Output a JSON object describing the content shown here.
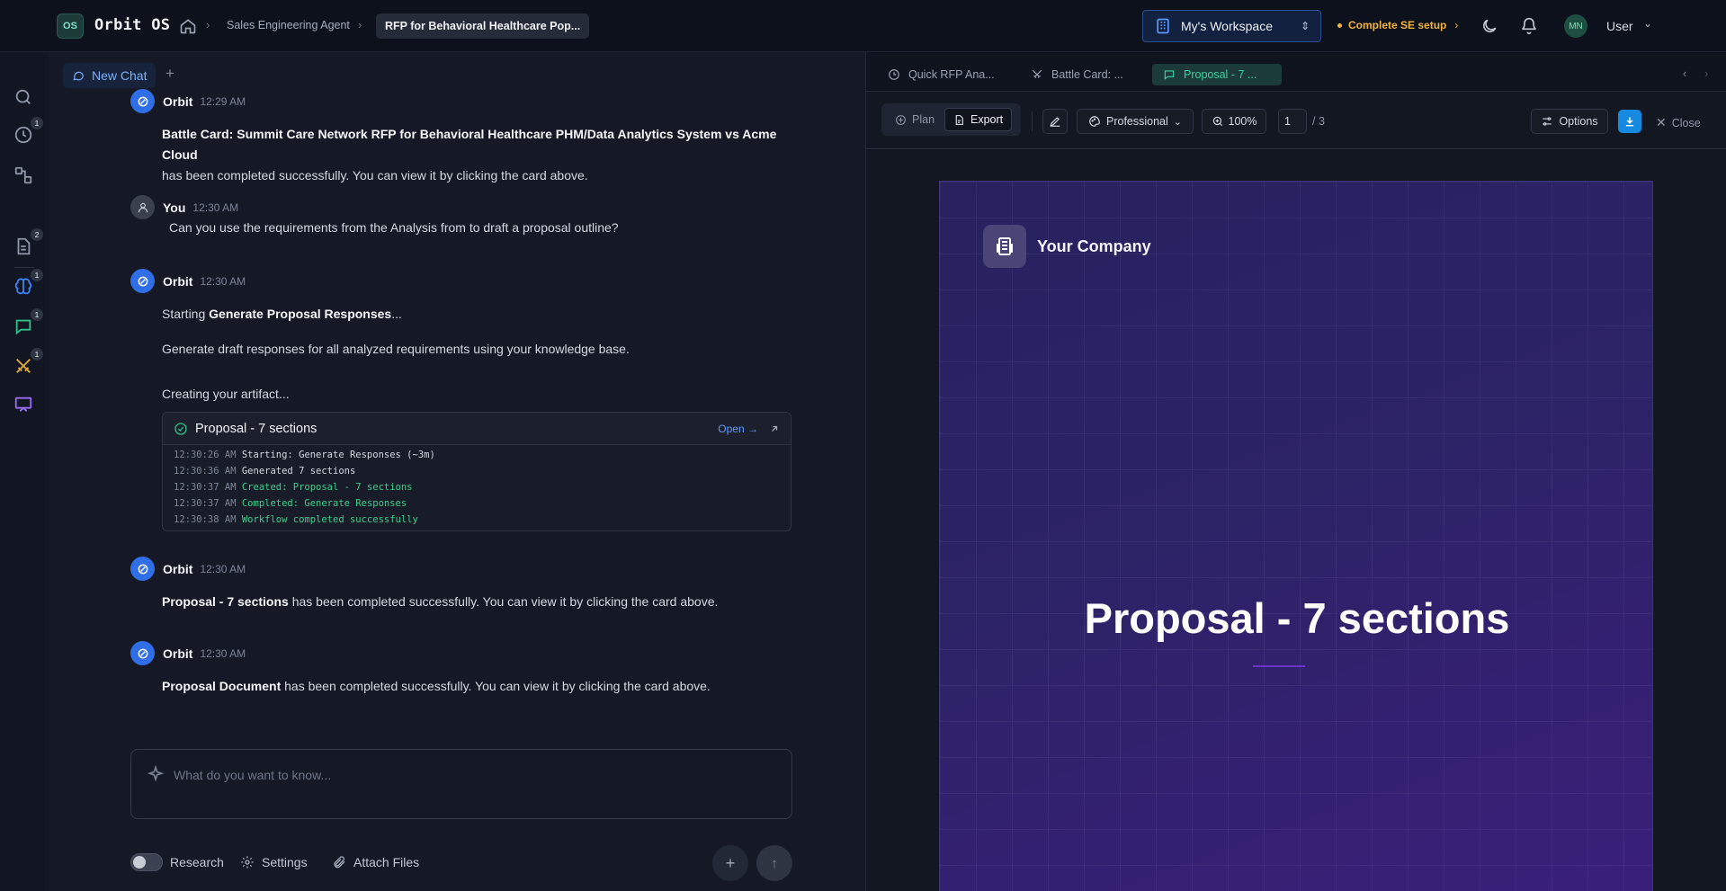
{
  "topbar": {
    "logo_text": "OS",
    "app_title": "Orbit OS",
    "breadcrumb_agent": "Sales Engineering Agent",
    "breadcrumb_current": "RFP for Behavioral Healthcare Pop...",
    "workspace": "My's Workspace",
    "setup_label": "Complete SE setup",
    "avatar_initials": "MN",
    "user_name": "User"
  },
  "rail": {
    "badges": {
      "history": "1",
      "documents": "2",
      "brain": "1",
      "chat": "1",
      "battle": "1"
    }
  },
  "chat": {
    "tab_label": "New Chat",
    "messages": [
      {
        "author": "Orbit",
        "time": "12:29 AM",
        "bold": "Battle Card: Summit Care Network RFP for Behavioral Healthcare PHM/Data Analytics System vs Acme Cloud",
        "text": "has been completed successfully. You can view it by clicking the card above."
      },
      {
        "author": "You",
        "time": "12:30 AM",
        "text": "Can you use the requirements from the Analysis from to draft a proposal outline?"
      },
      {
        "author": "Orbit",
        "time": "12:30 AM",
        "prefix": "Starting ",
        "bold": "Generate Proposal Responses",
        "suffix": "...",
        "line2": "Generate draft responses for all analyzed requirements using your knowledge base.",
        "line3": "Creating your artifact..."
      },
      {
        "author": "Orbit",
        "time": "12:30 AM",
        "bold": "Proposal - 7 sections",
        "text": " has been completed successfully. You can view it by clicking the card above."
      },
      {
        "author": "Orbit",
        "time": "12:30 AM",
        "bold": "Proposal Document",
        "text": " has been completed successfully. You can view it by clicking the card above."
      }
    ],
    "artifact": {
      "title": "Proposal - 7 sections",
      "open_label": "Open →",
      "log": [
        {
          "time": "12:30:26 AM",
          "text": "Starting: Generate Responses (~3m)",
          "status": "normal"
        },
        {
          "time": "12:30:36 AM",
          "text": "Generated 7 sections",
          "status": "normal"
        },
        {
          "time": "12:30:37 AM",
          "text": "Created: Proposal - 7 sections",
          "status": "success"
        },
        {
          "time": "12:30:37 AM",
          "text": "Completed: Generate Responses",
          "status": "success"
        },
        {
          "time": "12:30:38 AM",
          "text": "Workflow completed successfully",
          "status": "success"
        }
      ]
    },
    "composer_placeholder": "What do you want to know...",
    "research_label": "Research",
    "settings_label": "Settings",
    "attach_label": "Attach Files"
  },
  "right": {
    "tabs": [
      "Quick RFP Ana...",
      "Battle Card: ...",
      "Proposal - 7 ..."
    ],
    "active_tab": 2,
    "toolbar": {
      "plan_label": "Plan",
      "export_label": "Export",
      "style_label": "Professional",
      "zoom": "100%",
      "page_current": "1",
      "page_total": "/ 3",
      "options_label": "Options",
      "close_label": "Close"
    },
    "slide": {
      "company": "Your Company",
      "title": "Proposal - 7 sections"
    }
  },
  "colors": {
    "accent": "#2f6ee6",
    "success": "#3ecf8e",
    "warning": "#f3b23c",
    "slide_bg": "#2a2160"
  }
}
